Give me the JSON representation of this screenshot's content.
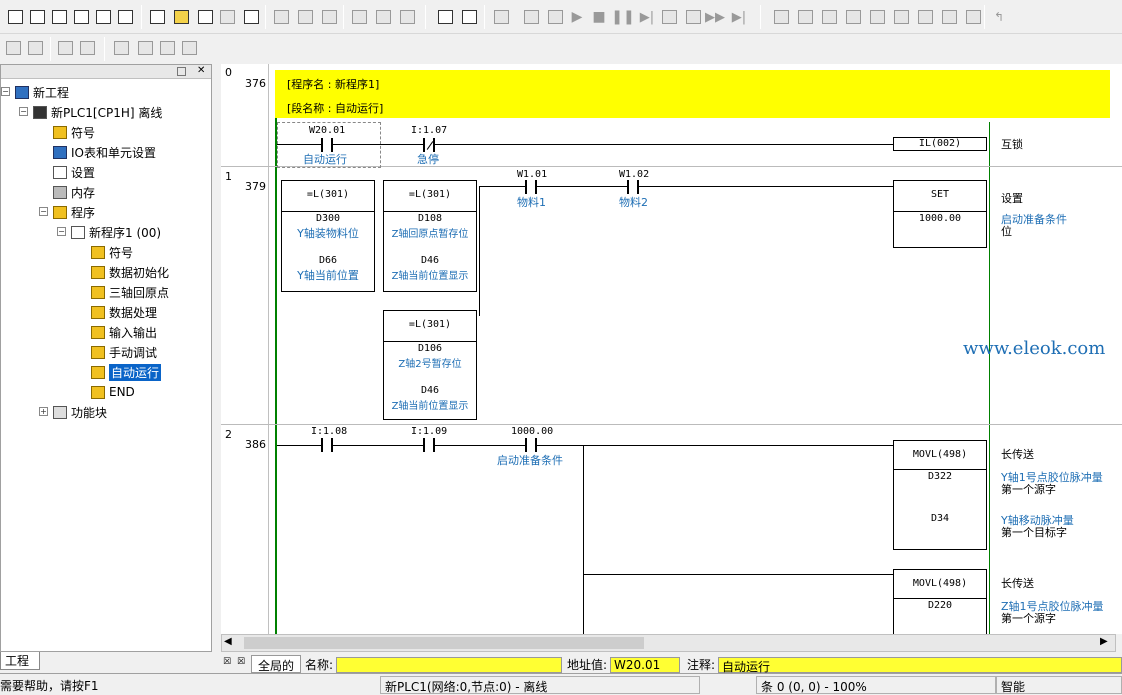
{
  "tree": {
    "root": "新工程",
    "plc": "新PLC1[CP1H] 离线",
    "symbols": "符号",
    "io_table": "IO表和单元设置",
    "settings": "设置",
    "memory": "内存",
    "programs": "程序",
    "new_program": "新程序1 (00)",
    "sections": [
      "符号",
      "数据初始化",
      "三轴回原点",
      "数据处理",
      "输入输出",
      "手动调试",
      "自动运行",
      "END"
    ],
    "selected": "自动运行",
    "function_blocks": "功能块"
  },
  "tabs": {
    "project": "工程"
  },
  "ladder": {
    "rung0": {
      "num": "0",
      "step": "376",
      "program_name": "[程序名 : 新程序1]",
      "section_name": "[段名称 : 自动运行]",
      "c1_addr": "W20.01",
      "c1_comment": "自动运行",
      "c2_addr": "I:1.07",
      "c2_comment": "急停",
      "instr": "IL(002)",
      "right_comment": "互锁"
    },
    "rung1": {
      "num": "1",
      "step": "379",
      "cmp1": {
        "op": "=L(301)",
        "s1": "D300",
        "s1c": "Y轴装物料位",
        "s2": "D66",
        "s2c": "Y轴当前位置"
      },
      "cmp2": {
        "op": "=L(301)",
        "s1": "D108",
        "s1c": "Z轴回原点暂存位",
        "s2": "D46",
        "s2c": "Z轴当前位置显示"
      },
      "cmp3": {
        "op": "=L(301)",
        "s1": "D106",
        "s1c": "Z轴2号暂存位",
        "s2": "D46",
        "s2c": "Z轴当前位置显示"
      },
      "c1_addr": "W1.01",
      "c1_comment": "物料1",
      "c2_addr": "W1.02",
      "c2_comment": "物料2",
      "instr": "SET",
      "operand": "1000.00",
      "right_title": "设置",
      "right_comment": "启动准备条件",
      "right_extra": "位"
    },
    "rung2": {
      "num": "2",
      "step": "386",
      "c1_addr": "I:1.08",
      "c2_addr": "I:1.09",
      "c3_addr": "1000.00",
      "c3_comment": "启动准备条件",
      "mov1": {
        "op": "MOVL(498)",
        "s": "D322",
        "d": "D34",
        "title": "长传送",
        "sc1": "Y轴1号点胶位脉冲量",
        "sc2": "第一个源字",
        "dc1": "Y轴移动脉冲量",
        "dc2": "第一个目标字"
      },
      "mov2": {
        "op": "MOVL(498)",
        "s": "D220",
        "title": "长传送",
        "sc1": "Z轴1号点胶位脉冲量",
        "sc2": "第一个源字"
      }
    },
    "watermark": "www.eleok.com"
  },
  "bottom": {
    "tab_global": "全局的",
    "name_label": "名称:",
    "addr_label": "地址值:",
    "addr_value": "W20.01",
    "comment_label": "注释:",
    "comment_value": "自动运行"
  },
  "status": {
    "help": "需要帮助，请按F1",
    "plc": "新PLC1(网络:0,节点:0) - 离线",
    "pos": "条 0 (0, 0) - 100%",
    "mode": "智能"
  }
}
